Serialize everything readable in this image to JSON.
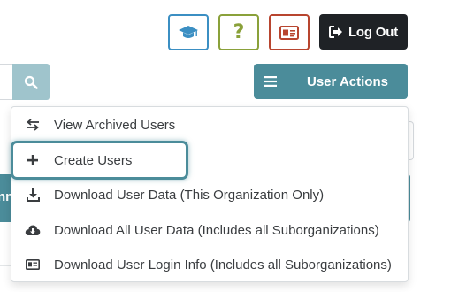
{
  "header": {
    "training_icon": "graduation-cap-icon",
    "help_label": "?",
    "card_icon": "id-card-icon",
    "logout_label": "Log Out",
    "logout_icon": "sign-out-icon",
    "colors": {
      "training": "#3b8fc3",
      "help": "#8aa13a",
      "card": "#b8452f",
      "logout_bg": "#1f2226"
    }
  },
  "search": {
    "button_icon": "search-icon",
    "button_color": "#9fc4cc"
  },
  "user_actions": {
    "label": "User Actions",
    "icon": "hamburger-icon",
    "color": "#4b8c9a"
  },
  "background": {
    "partial_label": "nn"
  },
  "menu": {
    "items": [
      {
        "label": "View Archived Users",
        "icon": "swap-arrows-icon"
      },
      {
        "label": "Create Users",
        "icon": "plus-icon",
        "highlighted": true
      },
      {
        "label": "Download User Data (This Organization Only)",
        "icon": "download-icon"
      },
      {
        "label": "Download All User Data (Includes all Suborganizations)",
        "icon": "cloud-download-icon"
      },
      {
        "label": "Download User Login Info (Includes all Suborganizations)",
        "icon": "id-card-icon"
      }
    ]
  }
}
